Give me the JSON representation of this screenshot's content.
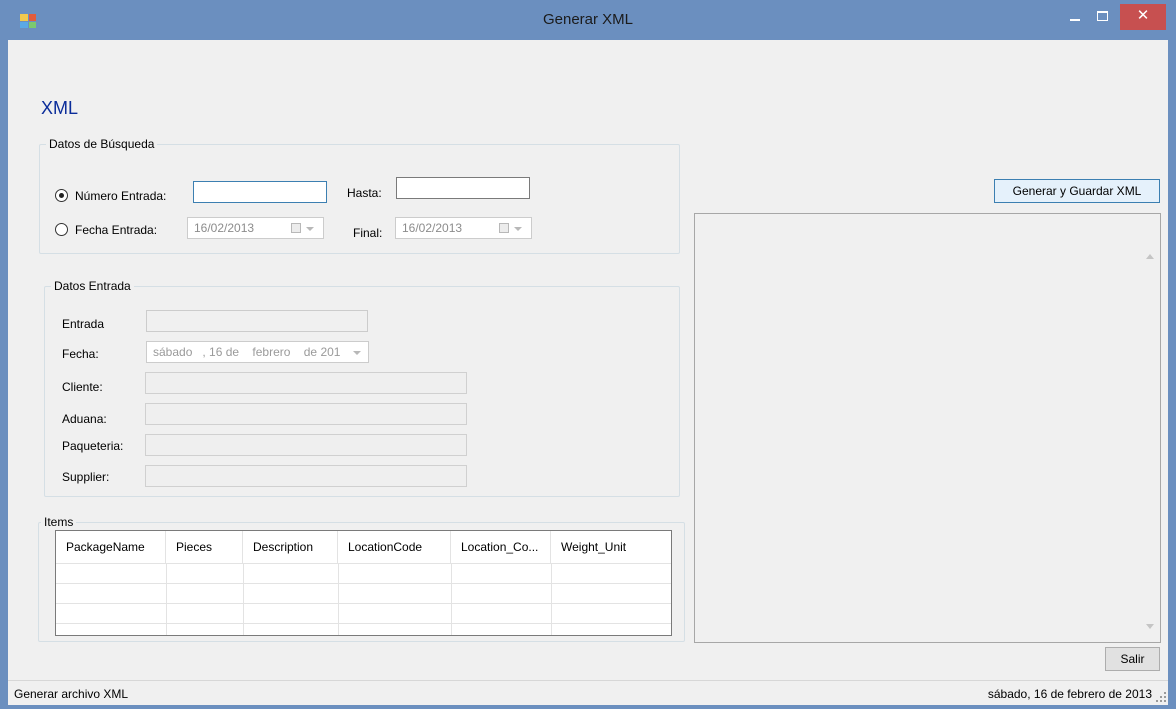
{
  "window": {
    "title": "Generar XML",
    "close_glyph": "✕",
    "icon": "app-window-icon"
  },
  "page": {
    "title": "XML"
  },
  "busqueda": {
    "legend": "Datos de Búsqueda",
    "numero_entrada": {
      "label": "Número Entrada:",
      "value": "",
      "selected": true
    },
    "hasta": {
      "label": "Hasta:",
      "value": ""
    },
    "fecha_entrada": {
      "label": "Fecha Entrada:",
      "value": "16/02/2013",
      "selected": false
    },
    "final": {
      "label": "Final:",
      "value": "16/02/2013"
    }
  },
  "entrada": {
    "legend": "Datos Entrada",
    "fields": [
      {
        "label": "Entrada",
        "value": ""
      },
      {
        "label": "Fecha:",
        "value": "sábado   , 16 de    febrero    de 201"
      },
      {
        "label": "Cliente:",
        "value": ""
      },
      {
        "label": "Aduana:",
        "value": ""
      },
      {
        "label": "Paqueteria:",
        "value": ""
      },
      {
        "label": "Supplier:",
        "value": ""
      }
    ]
  },
  "items": {
    "legend": "Items",
    "columns": [
      "PackageName",
      "Pieces",
      "Description",
      "LocationCode",
      "Location_Co...",
      "Weight_Unit"
    ],
    "rows": [
      [],
      [],
      []
    ]
  },
  "actions": {
    "generate_label": "Generar y Guardar XML",
    "exit_label": "Salir"
  },
  "output": {
    "text": ""
  },
  "status": {
    "left": "Generar archivo XML",
    "right": "sábado, 16 de febrero de 2013"
  },
  "colors": {
    "titlebar": "#6b8fbf",
    "close_button": "#c75050",
    "page_title": "#0b2d9a",
    "focus_border": "#3c7fb1"
  }
}
